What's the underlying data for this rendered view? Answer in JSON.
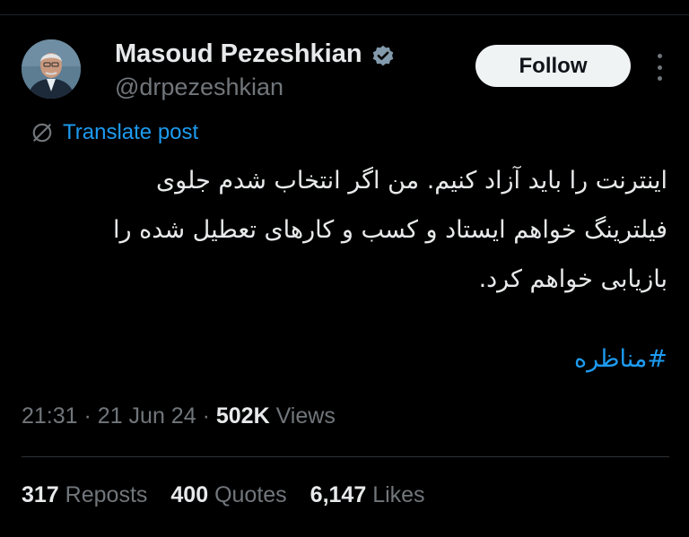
{
  "post": {
    "author": {
      "display_name": "Masoud Pezeshkian",
      "handle": "@drpezeshkian",
      "verified_icon": "verified-badge-icon",
      "avatar": "avatar-photo"
    },
    "follow_label": "Follow",
    "more_icon": "more-options-icon",
    "translate": {
      "icon": "translate-icon",
      "label": "Translate post"
    },
    "body_lines": [
      "اینترنت را باید آزاد کنیم. من اگر انتخاب شدم جلوی",
      "فیلترینگ خواهم ایستاد و کسب و کارهای تعطیل شده را",
      "بازیابی خواهم کرد."
    ],
    "hashtag": "#مناظره",
    "time": "21:31",
    "separator": "·",
    "date": "21 Jun 24",
    "views_count": "502K",
    "views_label": "Views",
    "stats": [
      {
        "count": "317",
        "label": "Reposts"
      },
      {
        "count": "400",
        "label": "Quotes"
      },
      {
        "count": "6,147",
        "label": "Likes"
      }
    ]
  },
  "colors": {
    "background": "#000000",
    "text": "#e7e9ea",
    "muted": "#71767b",
    "accent": "#1d9bf0",
    "verified": "#829aab",
    "follow_bg": "#eff3f4"
  }
}
